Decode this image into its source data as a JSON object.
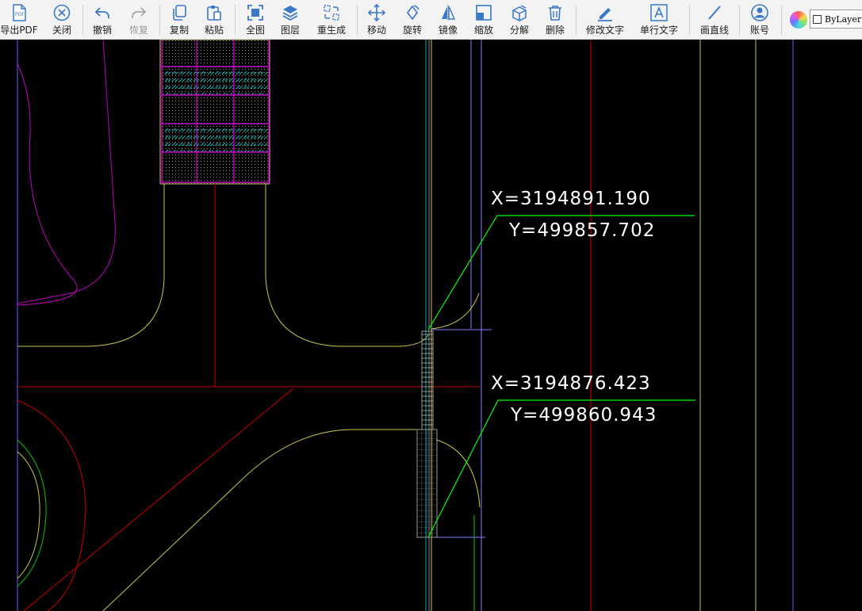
{
  "toolbar": {
    "export_pdf": "导出PDF",
    "close": "关闭",
    "undo": "撤销",
    "redo": "恢复",
    "copy": "复制",
    "paste": "粘贴",
    "zoom_extents": "全图",
    "layers": "图层",
    "regen": "重生成",
    "move": "移动",
    "rotate": "旋转",
    "mirror": "镜像",
    "scale": "缩放",
    "explode": "分解",
    "delete": "删除",
    "edit_text": "修改文字",
    "single_line_text": "单行文字",
    "draw_line": "画直线",
    "account": "账号",
    "layer_value": "ByLayer"
  },
  "drawing": {
    "coord1": {
      "x": "X=3194891.190",
      "y": "Y=499857.702"
    },
    "coord2": {
      "x": "X=3194876.423",
      "y": "Y=499860.943"
    }
  },
  "colors": {
    "toolbar_bg": "#f3f3f3",
    "icon_blue": "#3a78c8",
    "canvas_bg": "#000000",
    "leader_green": "#00ff00",
    "line_yellow": "#c8c850",
    "line_red": "#c80000",
    "line_magenta": "#c000c0",
    "line_blue": "#6464ff"
  }
}
